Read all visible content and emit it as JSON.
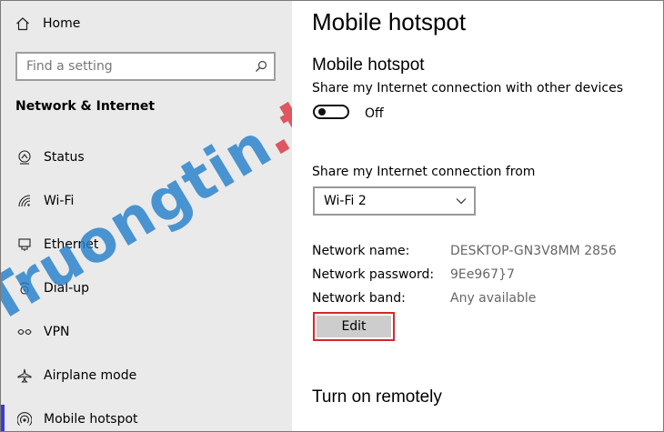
{
  "sidebar": {
    "home_label": "Home",
    "search_placeholder": "Find a setting",
    "section_title": "Network & Internet",
    "items": [
      {
        "label": "Status",
        "icon": "status-icon"
      },
      {
        "label": "Wi-Fi",
        "icon": "wifi-icon"
      },
      {
        "label": "Ethernet",
        "icon": "ethernet-icon"
      },
      {
        "label": "Dial-up",
        "icon": "dialup-icon"
      },
      {
        "label": "VPN",
        "icon": "vpn-icon"
      },
      {
        "label": "Airplane mode",
        "icon": "airplane-icon"
      },
      {
        "label": "Mobile hotspot",
        "icon": "hotspot-icon",
        "selected": true
      }
    ]
  },
  "watermark": {
    "text_main": "Truongtin",
    "text_dot": ".top"
  },
  "main": {
    "page_title": "Mobile hotspot",
    "section_heading": "Mobile hotspot",
    "share_desc": "Share my Internet connection with other devices",
    "toggle_state": "Off",
    "share_from_label": "Share my Internet connection from",
    "share_from_value": "Wi-Fi 2",
    "network_name_label": "Network name:",
    "network_name_value": "DESKTOP-GN3V8MM 2856",
    "network_password_label": "Network password:",
    "network_password_value": "9Ee967}7",
    "network_band_label": "Network band:",
    "network_band_value": "Any available",
    "edit_label": "Edit",
    "remote_heading": "Turn on remotely"
  },
  "colors": {
    "sidebar_bg": "#eaeaea",
    "selection_accent": "#3b3bd6",
    "edit_highlight": "#d22a2a",
    "watermark_blue": "#2680cc",
    "watermark_red": "#dc3c46"
  }
}
